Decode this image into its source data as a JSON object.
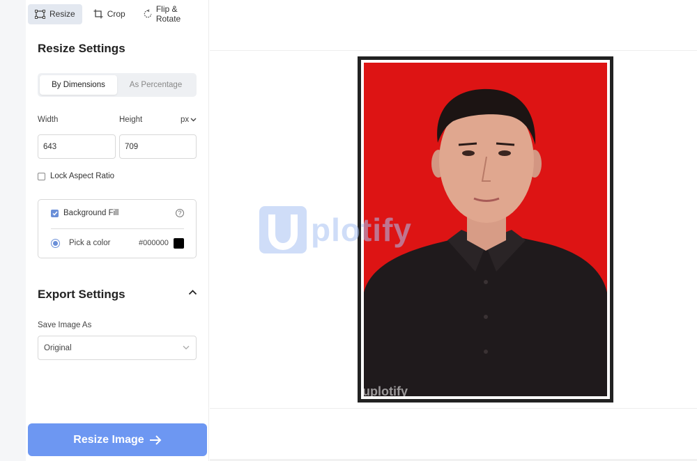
{
  "toolbar": {
    "tools": [
      {
        "label": "Resize",
        "icon": "resize-icon",
        "active": true
      },
      {
        "label": "Crop",
        "icon": "crop-icon",
        "active": false
      },
      {
        "label": "Flip & Rotate",
        "icon": "rotate-icon",
        "active": false
      }
    ]
  },
  "resize_settings": {
    "title": "Resize Settings",
    "tabs": [
      {
        "label": "By Dimensions",
        "active": true
      },
      {
        "label": "As Percentage",
        "active": false
      }
    ],
    "width_label": "Width",
    "height_label": "Height",
    "unit": "px",
    "width_value": "643",
    "height_value": "709",
    "lock_aspect_label": "Lock Aspect Ratio",
    "lock_aspect_checked": false,
    "background_fill_label": "Background Fill",
    "background_fill_checked": true,
    "pick_color_label": "Pick a color",
    "color_hex": "#000000"
  },
  "export_settings": {
    "title": "Export Settings",
    "save_as_label": "Save Image As",
    "save_as_value": "Original"
  },
  "action": {
    "resize_button_label": "Resize Image"
  },
  "preview": {
    "watermark_letter": "U",
    "watermark_text": "plotify",
    "watermark_small": "uplotify"
  },
  "colors": {
    "accent": "#6d97f2",
    "photo_background": "#dd1414",
    "frame": "#222222"
  }
}
